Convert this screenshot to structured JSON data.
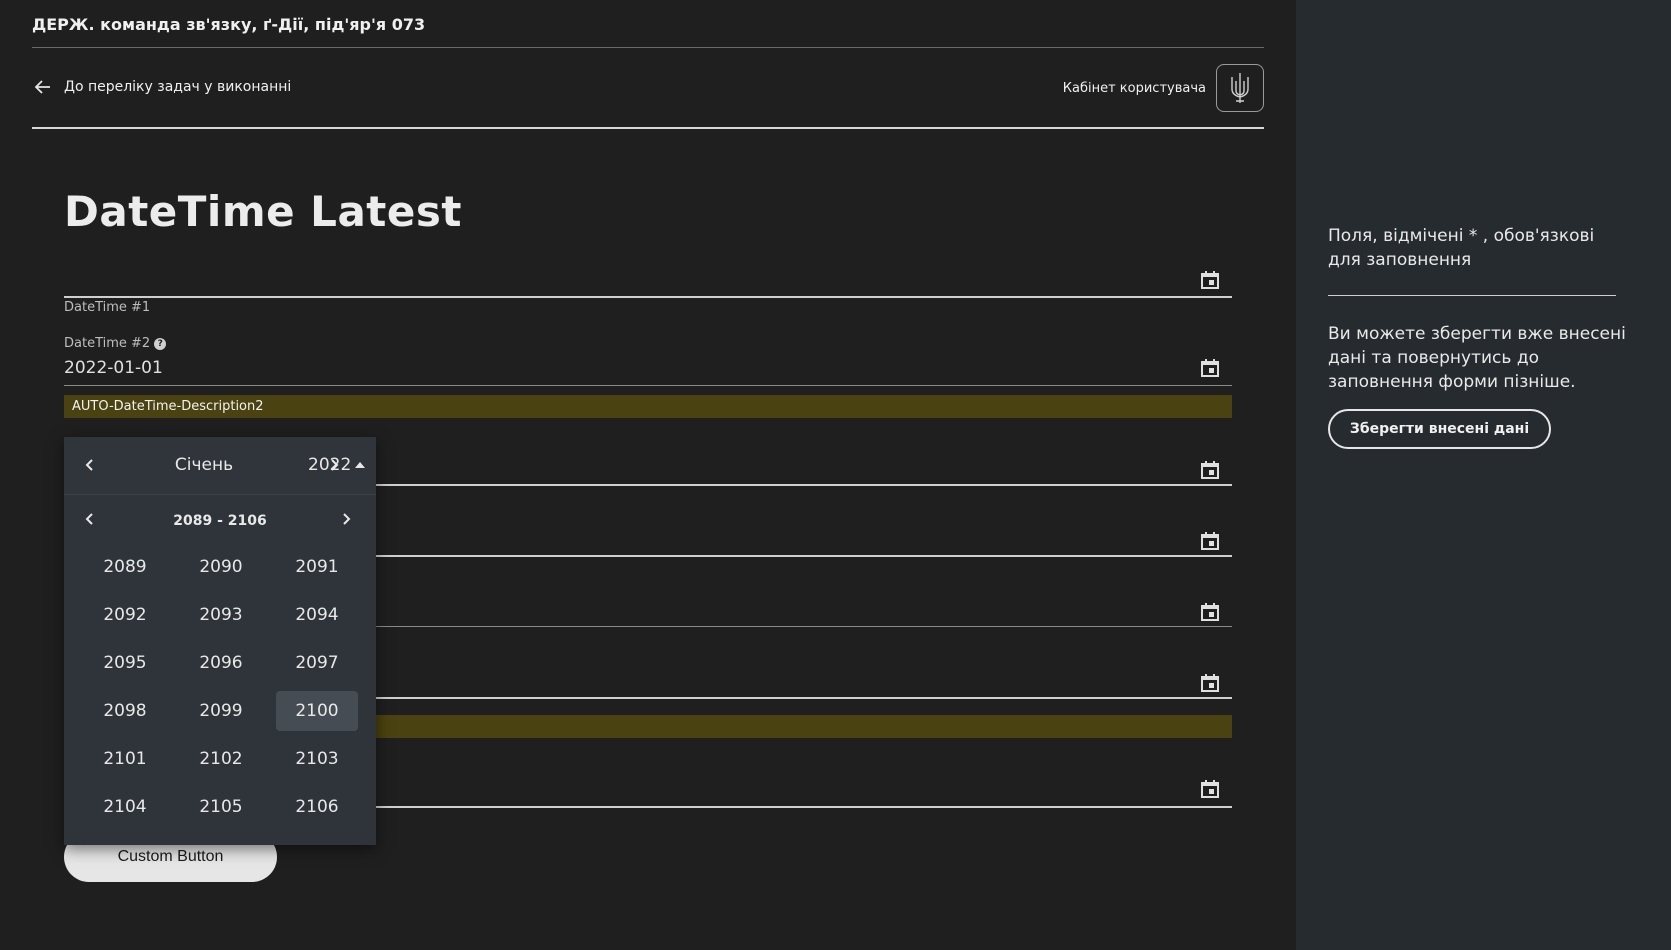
{
  "header": {
    "org_title": "ДЕРЖ. команда зв'язку, ґ-Дії, під'яр'я 073",
    "back_link": "До переліку задач у виконанні",
    "cabinet_label": "Кабінет користувача"
  },
  "page": {
    "title": "DateTime Latest"
  },
  "form": {
    "datetime1": {
      "value": "",
      "label": "DateTime #1"
    },
    "datetime2": {
      "label": "DateTime #2",
      "value": "2022-01-01",
      "description": "AUTO-DateTime-Description2"
    },
    "custom_button": "Custom Button"
  },
  "picker": {
    "month": "Січень",
    "year": "2022",
    "range_label": "2089 - 2106",
    "years": [
      "2089",
      "2090",
      "2091",
      "2092",
      "2093",
      "2094",
      "2095",
      "2096",
      "2097",
      "2098",
      "2099",
      "2100",
      "2101",
      "2102",
      "2103",
      "2104",
      "2105",
      "2106"
    ],
    "selected_year": "2100"
  },
  "aside": {
    "required_note": "Поля, відмічені * , обов'язкові для заповнення",
    "save_text": "Ви можете зберегти вже внесені дані та повернутись до заповнення форми пізніше.",
    "save_button": "Зберегти внесені дані"
  },
  "icons": {
    "back": "arrow-left-icon",
    "cabinet": "trident-icon",
    "calendar": "calendar-icon",
    "help": "help-icon"
  },
  "colors": {
    "background": "#1f1f1f",
    "aside_background": "#262b30",
    "description_bar": "#4a4210",
    "picker_background": "#2e343a"
  }
}
